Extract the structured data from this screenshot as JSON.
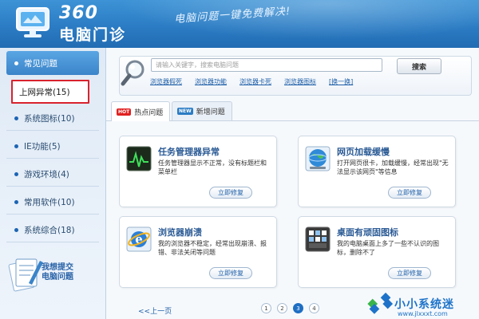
{
  "header": {
    "brand_number": "360",
    "brand_name": "电脑门诊",
    "slogan": "电脑问题一键免费解决!"
  },
  "sidebar": {
    "items": [
      {
        "label": "常见问题"
      },
      {
        "label": "上网异常(15)"
      },
      {
        "label": "系统图标(10)"
      },
      {
        "label": "IE功能(5)"
      },
      {
        "label": "游戏环境(4)"
      },
      {
        "label": "常用软件(10)"
      },
      {
        "label": "系统综合(18)"
      }
    ],
    "selected_index": 1,
    "feedback_label_line1": "我想提交",
    "feedback_label_line2": "电脑问题"
  },
  "search": {
    "placeholder": "请输入关键字，搜索电脑问题",
    "button_label": "搜索",
    "quick_links": [
      "浏览器假死",
      "浏览器功能",
      "浏览器卡死",
      "浏览器图标",
      "[换一换]"
    ]
  },
  "tabs": [
    {
      "badge": "HOT",
      "label": "热点问题",
      "active": true
    },
    {
      "badge": "NEW",
      "label": "新增问题",
      "active": false
    }
  ],
  "cards": [
    {
      "icon": "task-manager-icon",
      "title": "任务管理器异常",
      "desc": "任务管理器显示不正常，没有标题栏和菜单栏",
      "button": "立即修复"
    },
    {
      "icon": "globe-icon",
      "title": "网页加载缓慢",
      "desc": "打开网页很卡，加载缓慢，经常出现\"无法显示该网页\"等信息",
      "button": "立即修复"
    },
    {
      "icon": "ie-icon",
      "title": "浏览器崩溃",
      "desc": "我的浏览器不稳定，经常出现崩溃、报错、非法关闭等问题",
      "button": "立即修复"
    },
    {
      "icon": "desktop-icon",
      "title": "桌面有顽固图标",
      "desc": "我的电脑桌面上多了一些不认识的图标，删除不了",
      "button": "立即修复"
    }
  ],
  "pagination": {
    "prev_label": "<<上一页",
    "pages": [
      "1",
      "2",
      "3",
      "4"
    ],
    "current_page": "3"
  },
  "watermark": {
    "name": "小小系统迷",
    "url": "www.jlxxxt.com"
  },
  "colors": {
    "header_blue": "#2b7cc4",
    "selection_red": "#d9232d",
    "link_blue": "#1f5fa8",
    "hot_badge": "#e02020",
    "new_badge": "#2b7cc4"
  }
}
